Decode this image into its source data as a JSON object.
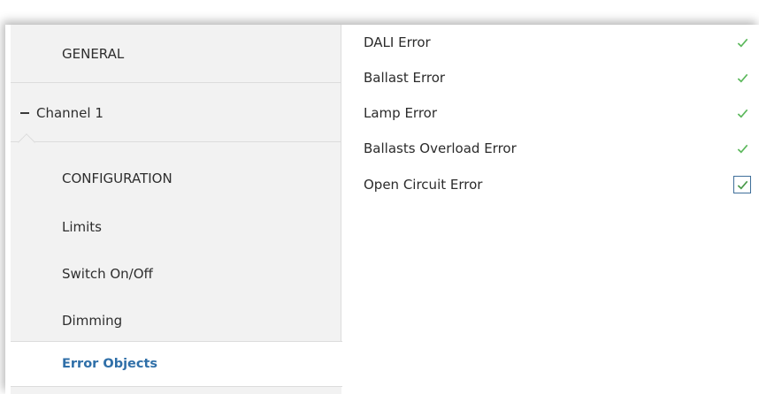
{
  "sidebar": {
    "general": "GENERAL",
    "channel": "Channel 1",
    "items": [
      "CONFIGURATION",
      "Limits",
      "Switch On/Off",
      "Dimming",
      "Error Objects"
    ],
    "selected": "Error Objects"
  },
  "options": [
    {
      "label": "DALI Error",
      "checked": true
    },
    {
      "label": "Ballast Error",
      "checked": true
    },
    {
      "label": "Lamp Error",
      "checked": true
    },
    {
      "label": "Ballasts Overload Error",
      "checked": true
    },
    {
      "label": "Open Circuit Error",
      "checked": true
    }
  ],
  "colors": {
    "accent": "#2f6fa8",
    "check": "#4caf50",
    "sidebar_bg": "#f2f2f2"
  }
}
